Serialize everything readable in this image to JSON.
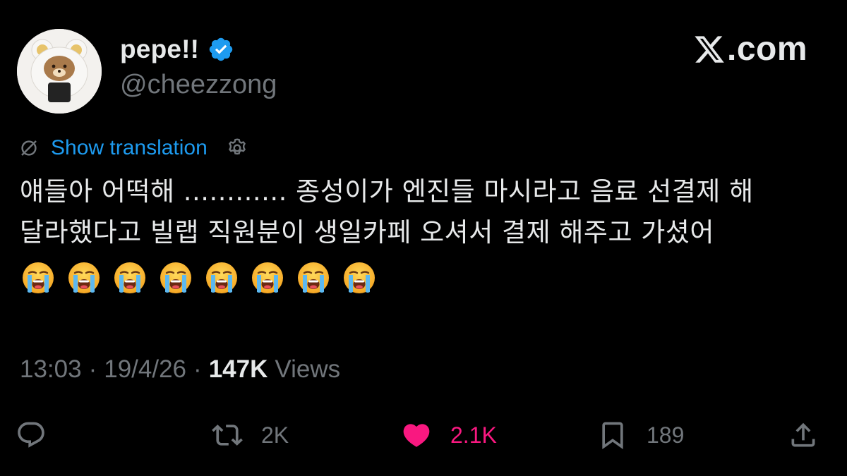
{
  "user": {
    "display_name": "pepe!!",
    "handle": "@cheezzong",
    "verified": true
  },
  "brand": {
    "text": ".com"
  },
  "translation": {
    "label": "Show translation"
  },
  "tweet": {
    "lines": [
      "얘들아 어떡해 ............ 종성이가 엔진들 마시라고 음료 선결제 해",
      "달라했다고 빌랩 직원분이 생일카페 오셔서 결제 해주고 가셨어"
    ],
    "emoji_count": 8,
    "emoji_name": "loudly-crying-face"
  },
  "meta": {
    "time": "13:03",
    "date": "19/4/26",
    "separator": "·",
    "views_count": "147K",
    "views_label": "Views"
  },
  "actions": {
    "replies": "",
    "reposts": "2K",
    "likes": "2.1K",
    "bookmarks": "189"
  },
  "colors": {
    "background": "#000000",
    "text": "#e7e9ea",
    "muted": "#71767b",
    "link": "#1d9bf0",
    "like": "#f91880",
    "verified": "#1d9bf0"
  }
}
